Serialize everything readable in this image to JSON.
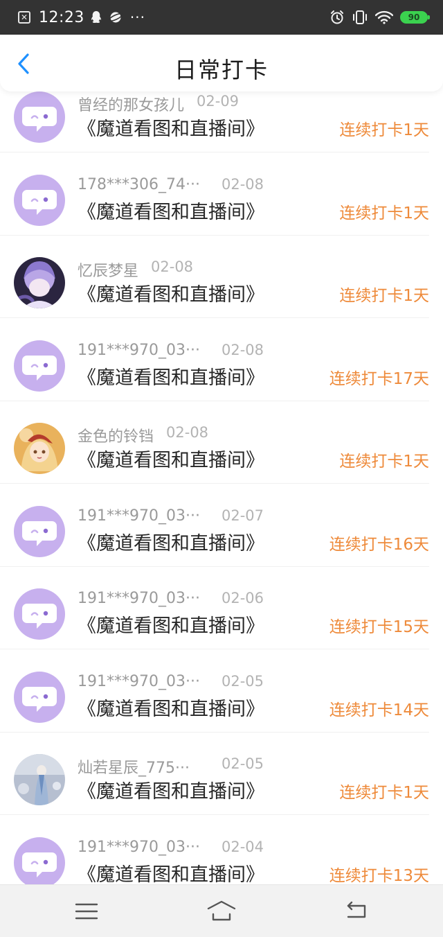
{
  "status_bar": {
    "time": "12:23",
    "battery": "90",
    "icons": [
      "app-notification-icon",
      "qq-icon",
      "planet-icon",
      "more-dots-icon",
      "alarm-icon",
      "vibrate-icon",
      "wifi-icon",
      "battery-icon"
    ],
    "more": "···"
  },
  "header": {
    "title": "日常打卡",
    "back_icon": "chevron-left-icon"
  },
  "colors": {
    "accent": "#1E90FF",
    "streak": "#EE8A3A",
    "avatar_default": "#C7B0EE",
    "username": "#9A9A9A"
  },
  "records": [
    {
      "user": "曾经的那女孩儿",
      "date": "02-09",
      "title": "《魔道看图和直播间》",
      "streak": "连续打卡1天",
      "avatar": "default"
    },
    {
      "user": "178***306_74···",
      "date": "02-08",
      "title": "《魔道看图和直播间》",
      "streak": "连续打卡1天",
      "avatar": "default"
    },
    {
      "user": "忆辰梦星",
      "date": "02-08",
      "title": "《魔道看图和直播间》",
      "streak": "连续打卡1天",
      "avatar": "photo"
    },
    {
      "user": "191***970_03···",
      "date": "02-08",
      "title": "《魔道看图和直播间》",
      "streak": "连续打卡17天",
      "avatar": "default"
    },
    {
      "user": "金色的铃铛",
      "date": "02-08",
      "title": "《魔道看图和直播间》",
      "streak": "连续打卡1天",
      "avatar": "photo"
    },
    {
      "user": "191***970_03···",
      "date": "02-07",
      "title": "《魔道看图和直播间》",
      "streak": "连续打卡16天",
      "avatar": "default"
    },
    {
      "user": "191***970_03···",
      "date": "02-06",
      "title": "《魔道看图和直播间》",
      "streak": "连续打卡15天",
      "avatar": "default"
    },
    {
      "user": "191***970_03···",
      "date": "02-05",
      "title": "《魔道看图和直播间》",
      "streak": "连续打卡14天",
      "avatar": "default"
    },
    {
      "user": "灿若星辰_775···",
      "date": "02-05",
      "title": "《魔道看图和直播间》",
      "streak": "连续打卡1天",
      "avatar": "photo"
    },
    {
      "user": "191***970_03···",
      "date": "02-04",
      "title": "《魔道看图和直播间》",
      "streak": "连续打卡13天",
      "avatar": "default"
    }
  ],
  "navbar": {
    "icons": [
      "menu-icon",
      "home-icon",
      "back-icon"
    ]
  }
}
